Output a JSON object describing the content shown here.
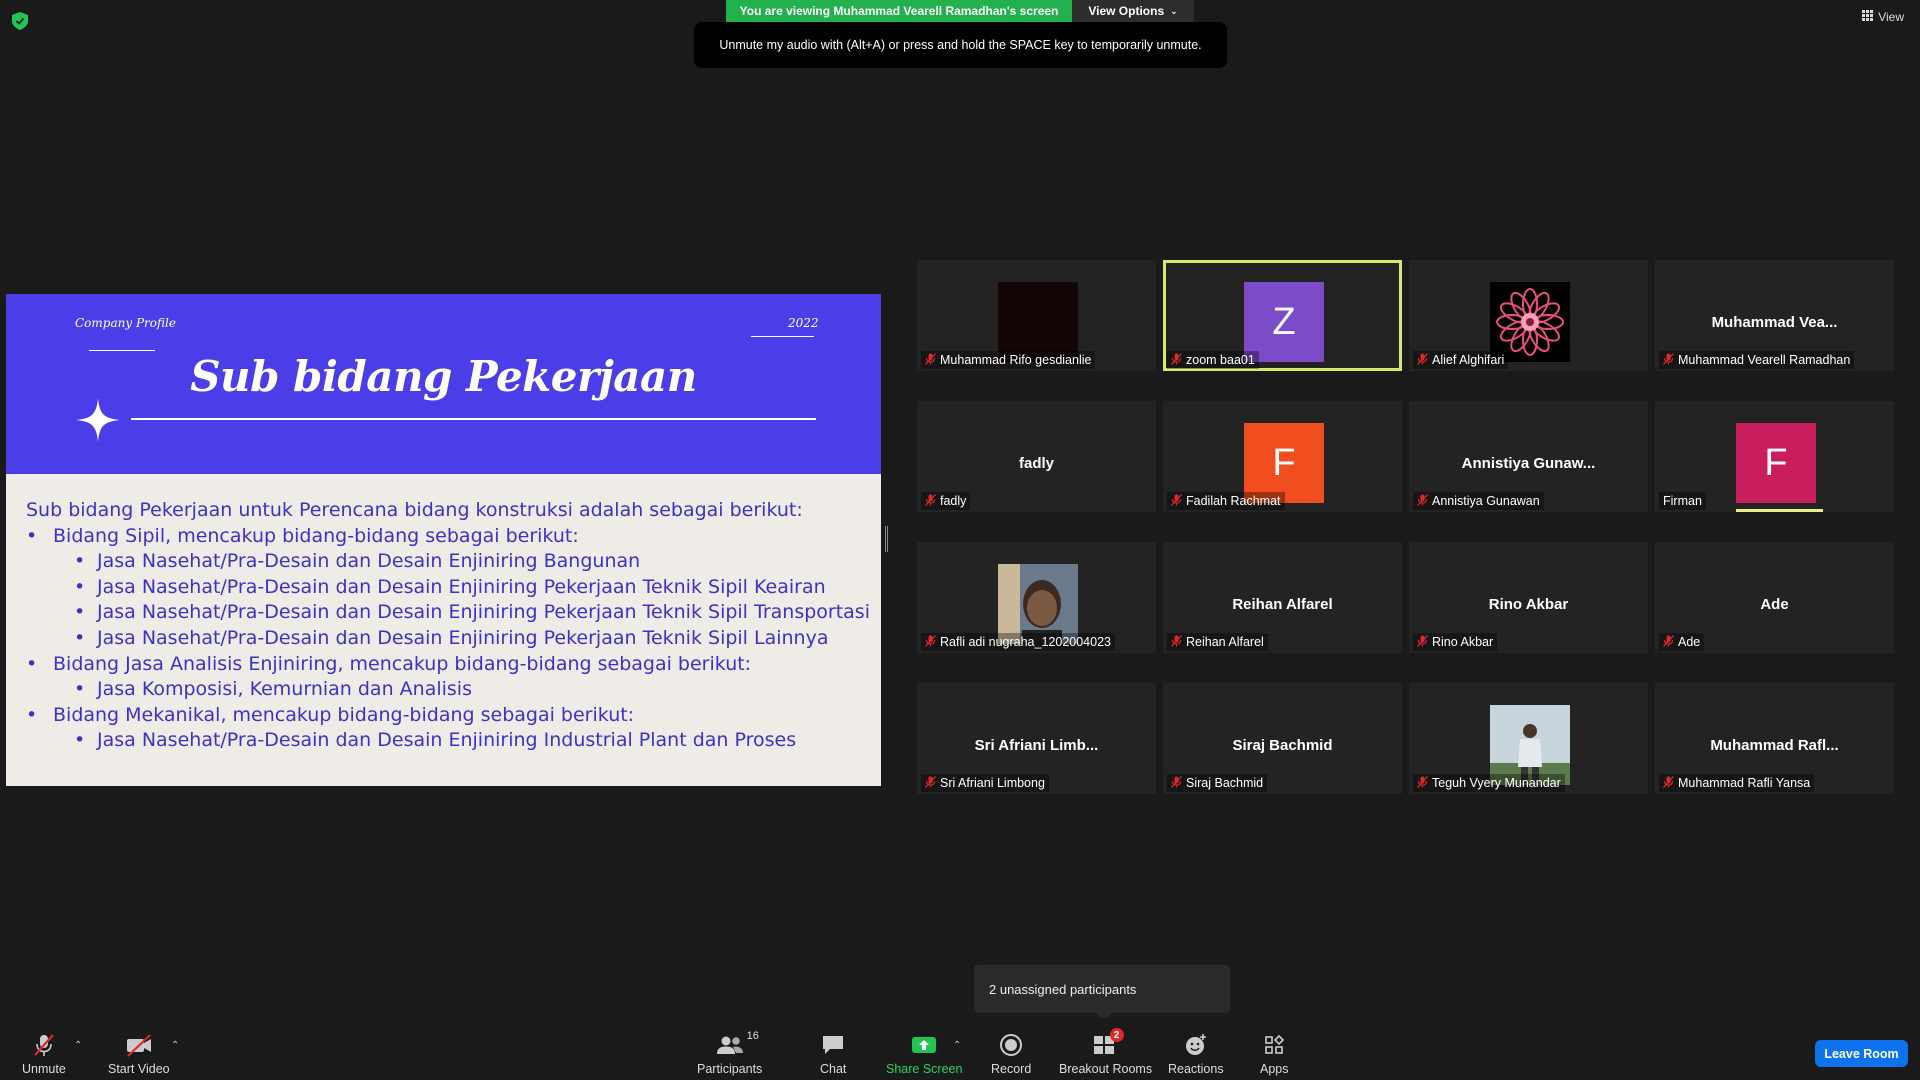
{
  "top": {
    "viewing_banner": "You are viewing Muhammad Vearell Ramadhan's screen",
    "view_options": "View Options",
    "unmute_tip": "Unmute my audio with (Alt+A) or press and hold the SPACE key to temporarily unmute.",
    "view": "View"
  },
  "slide": {
    "company_profile": "Company Profile",
    "year": "2022",
    "title": "Sub bidang Pekerjaan",
    "lines": [
      "Sub bidang Pekerjaan untuk Perencana bidang konstruksi adalah sebagai berikut:",
      "Bidang Sipil, mencakup bidang-bidang sebagai berikut:",
      "Jasa Nasehat/Pra-Desain dan Desain Enjiniring Bangunan",
      "Jasa Nasehat/Pra-Desain dan Desain Enjiniring Pekerjaan Teknik Sipil Keairan",
      "Jasa Nasehat/Pra-Desain dan Desain Enjiniring Pekerjaan Teknik Sipil Transportasi",
      "Jasa Nasehat/Pra-Desain dan Desain Enjiniring Pekerjaan Teknik Sipil Lainnya",
      "Bidang Jasa Analisis Enjiniring, mencakup bidang-bidang sebagai berikut:",
      "Jasa Komposisi, Kemurnian dan Analisis",
      "Bidang Mekanikal, mencakup bidang-bidang sebagai berikut:",
      "Jasa Nasehat/Pra-Desain dan Desain Enjiniring Industrial Plant dan Proses"
    ]
  },
  "participants": [
    {
      "label": "Muhammad Rifo gesdianlie",
      "big": "",
      "avatar_letter": "",
      "avatar_color": "#120606",
      "avatar_kind": "photo-dark",
      "muted": true
    },
    {
      "label": "zoom baa01",
      "big": "",
      "avatar_letter": "Z",
      "avatar_color": "#7c4bc8",
      "avatar_kind": "letter",
      "muted": true
    },
    {
      "label": "Alief Alghifari",
      "big": "",
      "avatar_letter": "",
      "avatar_color": "#000000",
      "avatar_kind": "mandala",
      "muted": true
    },
    {
      "label": "Muhammad Vearell Ramadhan",
      "big": "Muhammad  Vea...",
      "avatar_letter": "",
      "avatar_color": "",
      "avatar_kind": "none",
      "muted": true
    },
    {
      "label": "fadly",
      "big": "fadly",
      "avatar_letter": "",
      "avatar_color": "",
      "avatar_kind": "none",
      "muted": true
    },
    {
      "label": "Fadilah Rachmat",
      "big": "",
      "avatar_letter": "F",
      "avatar_color": "#f04e1e",
      "avatar_kind": "letter",
      "muted": true
    },
    {
      "label": "Annistiya Gunawan",
      "big": "Annistiya  Gunaw...",
      "avatar_letter": "",
      "avatar_color": "",
      "avatar_kind": "none",
      "muted": true
    },
    {
      "label": "Firman",
      "big": "",
      "avatar_letter": "F",
      "avatar_color": "#c91d5e",
      "avatar_kind": "letter",
      "muted": false
    },
    {
      "label": "Rafli adi nugraha_1202004023",
      "big": "",
      "avatar_letter": "",
      "avatar_color": "#5a6a7c",
      "avatar_kind": "photo-face",
      "muted": true
    },
    {
      "label": "Reihan Alfarel",
      "big": "Reihan Alfarel",
      "avatar_letter": "",
      "avatar_color": "",
      "avatar_kind": "none",
      "muted": true
    },
    {
      "label": "Rino Akbar",
      "big": "Rino Akbar",
      "avatar_letter": "",
      "avatar_color": "",
      "avatar_kind": "none",
      "muted": true
    },
    {
      "label": "Ade",
      "big": "Ade",
      "avatar_letter": "",
      "avatar_color": "",
      "avatar_kind": "none",
      "muted": true
    },
    {
      "label": "Sri Afriani Limbong",
      "big": "Sri  Afriani  Limb...",
      "avatar_letter": "",
      "avatar_color": "",
      "avatar_kind": "none",
      "muted": true
    },
    {
      "label": "Siraj Bachmid",
      "big": "Siraj Bachmid",
      "avatar_letter": "",
      "avatar_color": "",
      "avatar_kind": "none",
      "muted": true
    },
    {
      "label": "Teguh Vyery Munandar",
      "big": "",
      "avatar_letter": "",
      "avatar_color": "#b9c7cf",
      "avatar_kind": "photo-person",
      "muted": true
    },
    {
      "label": "Muhammad Rafli Yansa",
      "big": "Muhammad  Rafl...",
      "avatar_letter": "",
      "avatar_color": "",
      "avatar_kind": "none",
      "muted": true
    }
  ],
  "tooltip": {
    "unassigned": "2 unassigned participants"
  },
  "toolbar": {
    "unmute": "Unmute",
    "start_video": "Start Video",
    "participants": "Participants",
    "participants_count": "16",
    "chat": "Chat",
    "share_screen": "Share Screen",
    "record": "Record",
    "breakout_rooms": "Breakout Rooms",
    "breakout_badge": "2",
    "reactions": "Reactions",
    "apps": "Apps",
    "leave_room": "Leave Room"
  },
  "colors": {
    "accent_green": "#22b14c",
    "leave_blue": "#0e72ed",
    "active_speaker": "#d4ea6e",
    "slide_blue": "#4b3de8"
  }
}
